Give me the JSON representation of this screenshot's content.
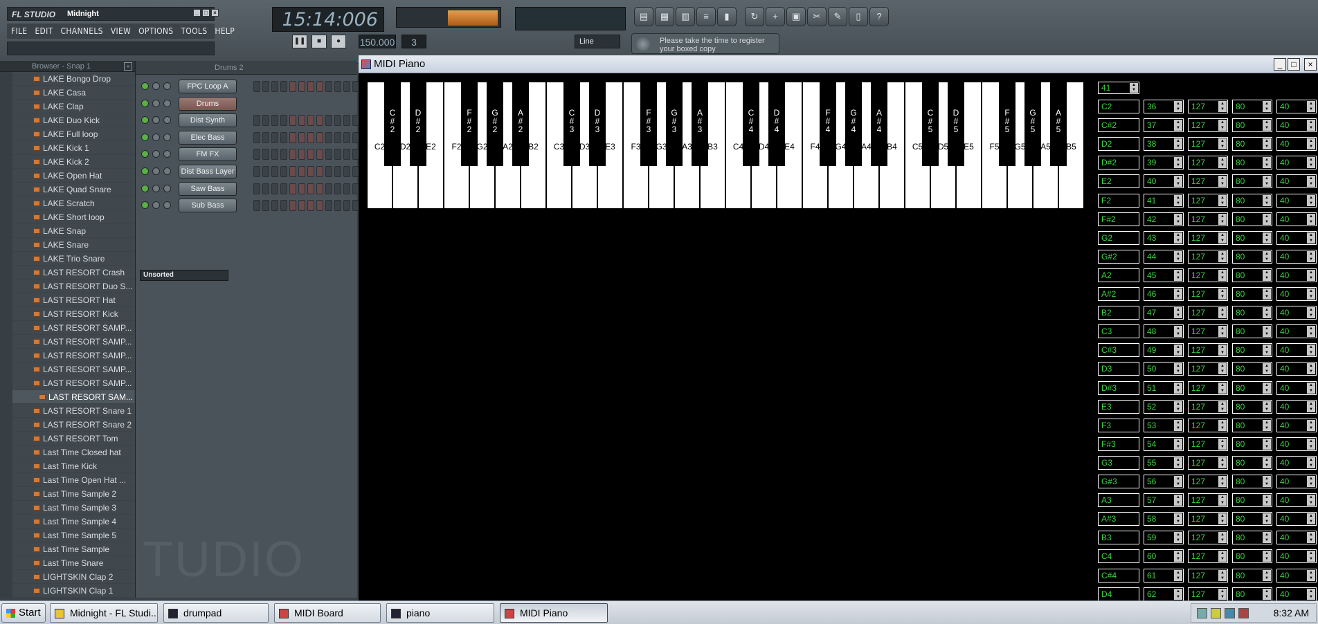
{
  "fl": {
    "logo": "FL STUDIO",
    "project": "Midnight",
    "menu": [
      "FILE",
      "EDIT",
      "CHANNELS",
      "VIEW",
      "OPTIONS",
      "TOOLS",
      "HELP"
    ],
    "time": "15:14:006",
    "tempo": "150.000",
    "pattern": "3",
    "snap": "Line",
    "news": "Please take the time to register your boxed copy",
    "browser_title": "Browser - Snap 1",
    "channel_pattern": "Drums 2",
    "unsorted": "Unsorted",
    "studio_text": "TUDIO"
  },
  "browser_items": [
    "LAKE Bongo Drop",
    "LAKE Casa",
    "LAKE Clap",
    "LAKE Duo Kick",
    "LAKE Full loop",
    "LAKE Kick 1",
    "LAKE Kick 2",
    "LAKE Open Hat",
    "LAKE Quad Snare",
    "LAKE Scratch",
    "LAKE Short loop",
    "LAKE Snap",
    "LAKE Snare",
    "LAKE Trio Snare",
    "LAST RESORT Crash",
    "LAST RESORT Duo S...",
    "LAST RESORT Hat",
    "LAST RESORT Kick",
    "LAST RESORT SAMP...",
    "LAST RESORT SAMP...",
    "LAST RESORT SAMP...",
    "LAST RESORT SAMP...",
    "LAST RESORT SAMP...",
    "LAST RESORT SAM...",
    "LAST RESORT Snare 1",
    "LAST RESORT Snare 2",
    "LAST RESORT Tom",
    "Last Time Closed hat",
    "Last Time Kick",
    "Last Time Open Hat ...",
    "Last Time Sample 2",
    "Last Time Sample 3",
    "Last Time Sample 4",
    "Last Time Sample 5",
    "Last Time Sample",
    "Last Time Snare",
    "LIGHTSKIN  Clap 2",
    "LIGHTSKIN Clap 1"
  ],
  "channels": [
    "FPC Loop A",
    "Drums",
    "Dist Synth",
    "Elec Bass",
    "FM FX",
    "Dist Bass Layer",
    "Saw Bass",
    "Sub Bass"
  ],
  "midi": {
    "title": "MIDI Piano",
    "white_keys": [
      "C2",
      "D2",
      "E2",
      "F2",
      "G2",
      "A2",
      "B2",
      "C3",
      "D3",
      "E3",
      "F3",
      "G3",
      "A3",
      "B3",
      "C4",
      "D4",
      "E4",
      "F4",
      "G4",
      "A4",
      "B4",
      "C5",
      "D5",
      "E5",
      "F5",
      "G5",
      "A5",
      "B5"
    ],
    "black_keys": [
      "C\n#\n2",
      "D\n#\n2",
      "F\n#\n2",
      "G\n#\n2",
      "A\n#\n2",
      "C\n#\n3",
      "D\n#\n3",
      "F\n#\n3",
      "G\n#\n3",
      "A\n#\n3",
      "C\n#\n4",
      "D\n#\n4",
      "F\n#\n4",
      "G\n#\n4",
      "A\n#\n4",
      "C\n#\n5",
      "D\n#\n5",
      "F\n#\n5",
      "G\n#\n5",
      "A\n#\n5"
    ],
    "top_value": "41",
    "rows": [
      [
        "C2",
        "36",
        "127",
        "80",
        "40"
      ],
      [
        "C#2",
        "37",
        "127",
        "80",
        "40"
      ],
      [
        "D2",
        "38",
        "127",
        "80",
        "40"
      ],
      [
        "D#2",
        "39",
        "127",
        "80",
        "40"
      ],
      [
        "E2",
        "40",
        "127",
        "80",
        "40"
      ],
      [
        "F2",
        "41",
        "127",
        "80",
        "40"
      ],
      [
        "F#2",
        "42",
        "127",
        "80",
        "40"
      ],
      [
        "G2",
        "43",
        "127",
        "80",
        "40"
      ],
      [
        "G#2",
        "44",
        "127",
        "80",
        "40"
      ],
      [
        "A2",
        "45",
        "127",
        "80",
        "40"
      ],
      [
        "A#2",
        "46",
        "127",
        "80",
        "40"
      ],
      [
        "B2",
        "47",
        "127",
        "80",
        "40"
      ],
      [
        "C3",
        "48",
        "127",
        "80",
        "40"
      ],
      [
        "C#3",
        "49",
        "127",
        "80",
        "40"
      ],
      [
        "D3",
        "50",
        "127",
        "80",
        "40"
      ],
      [
        "D#3",
        "51",
        "127",
        "80",
        "40"
      ],
      [
        "E3",
        "52",
        "127",
        "80",
        "40"
      ],
      [
        "F3",
        "53",
        "127",
        "80",
        "40"
      ],
      [
        "F#3",
        "54",
        "127",
        "80",
        "40"
      ],
      [
        "G3",
        "55",
        "127",
        "80",
        "40"
      ],
      [
        "G#3",
        "56",
        "127",
        "80",
        "40"
      ],
      [
        "A3",
        "57",
        "127",
        "80",
        "40"
      ],
      [
        "A#3",
        "58",
        "127",
        "80",
        "40"
      ],
      [
        "B3",
        "59",
        "127",
        "80",
        "40"
      ],
      [
        "C4",
        "60",
        "127",
        "80",
        "40"
      ],
      [
        "C#4",
        "61",
        "127",
        "80",
        "40"
      ],
      [
        "D4",
        "62",
        "127",
        "80",
        "40"
      ]
    ]
  },
  "taskbar": {
    "start": "Start",
    "tasks": [
      "Midnight - FL Studi...",
      "drumpad",
      "MIDI Board",
      "piano",
      "MIDI Piano"
    ],
    "clock": "8:32 AM"
  },
  "colors": {
    "grid_text": "#3cd040",
    "background": "#000000"
  }
}
